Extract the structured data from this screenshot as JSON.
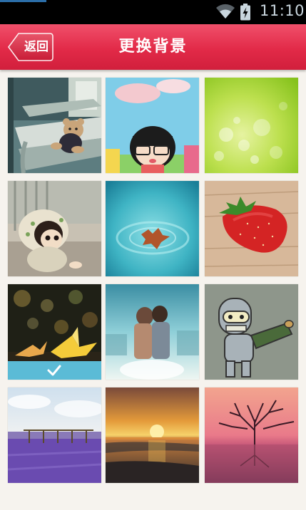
{
  "status_bar": {
    "time": "11:10",
    "icons": [
      "wifi-icon",
      "battery-charging-icon"
    ]
  },
  "title_bar": {
    "back_label": "返回",
    "title": "更换背景"
  },
  "wallpapers": [
    {
      "name": "teddy-bear-on-bench"
    },
    {
      "name": "cartoon-girl-with-glasses"
    },
    {
      "name": "green-bokeh"
    },
    {
      "name": "doll-in-hood"
    },
    {
      "name": "leaf-on-water"
    },
    {
      "name": "strawberry-on-wood"
    },
    {
      "name": "paper-cranes-bokeh",
      "selected": true
    },
    {
      "name": "couple-kissing"
    },
    {
      "name": "robot-cartoon"
    },
    {
      "name": "lavender-field"
    },
    {
      "name": "sunset-beach"
    },
    {
      "name": "tree-in-pink-sunset"
    }
  ],
  "colors": {
    "title_bar": "#e22a48",
    "selected_bar": "#5bbbd6",
    "background": "#f6f3ee"
  }
}
